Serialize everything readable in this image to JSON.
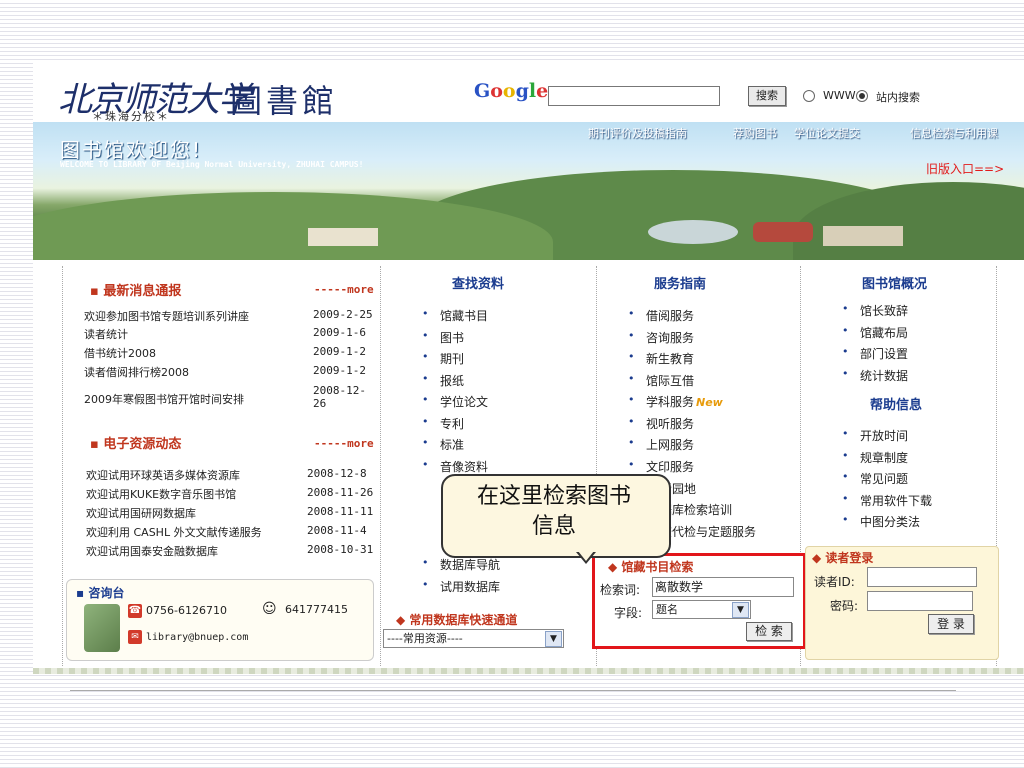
{
  "header": {
    "logo_cn": "北京师范大学",
    "logo_sub": "＊珠海分校＊",
    "logo_lib": "圖書館",
    "google": [
      "G",
      "o",
      "o",
      "g",
      "l",
      "e"
    ],
    "search_button": "搜索",
    "radio_www": "WWW",
    "radio_site": "站内搜索"
  },
  "banner": {
    "title": "图书馆欢迎您!",
    "subtitle": "WELCOME TO LIBRARY OF Beijing Normal University, ZHUHAI CAMPUS!",
    "nav": [
      "期刊评价及投稿指南",
      "荐购图书",
      "学位论文提交",
      "信息检索与利用课"
    ],
    "old_entry": "旧版入口==>"
  },
  "news": {
    "title": "最新消息通报",
    "more": "-----more",
    "items": [
      {
        "text": "欢迎参加图书馆专题培训系列讲座",
        "date": "2009-2-25"
      },
      {
        "text": "读者统计",
        "date": "2009-1-6"
      },
      {
        "text": "借书统计2008",
        "date": "2009-1-2"
      },
      {
        "text": "读者借阅排行榜2008",
        "date": "2009-1-2"
      },
      {
        "text": "2009年寒假图书馆开馆时间安排",
        "date": "2008-12-26"
      }
    ]
  },
  "eresource": {
    "title": "电子资源动态",
    "more": "-----more",
    "items": [
      {
        "text": "欢迎试用环球英语多媒体资源库",
        "date": "2008-12-8"
      },
      {
        "text": "欢迎试用KUKE数字音乐图书馆",
        "date": "2008-11-26"
      },
      {
        "text": "欢迎试用国研网数据库",
        "date": "2008-11-11"
      },
      {
        "text": "欢迎利用 CASHL 外文文献传递服务",
        "date": "2008-11-4"
      },
      {
        "text": "欢迎试用国泰安金融数据库",
        "date": "2008-10-31"
      }
    ]
  },
  "consult": {
    "title": "咨询台",
    "phone": "0756-6126710",
    "qq": "641777415",
    "email": "library@bnuep.com"
  },
  "find": {
    "title": "查找资料",
    "items": [
      "馆藏书目",
      "图书",
      "期刊",
      "报纸",
      "学位论文",
      "专利",
      "标准",
      "音像资料"
    ],
    "items2": [
      "数据库导航",
      "试用数据库"
    ]
  },
  "quick": {
    "title": "常用数据库快速通道",
    "select": "----常用资源----"
  },
  "service": {
    "title": "服务指南",
    "items": [
      "借阅服务",
      "咨询服务",
      "新生教育",
      "馆际互借",
      "学科服务",
      "视听服务",
      "上网服务",
      "文印服务"
    ],
    "new_badge": "New",
    "partial": [
      "者园地",
      "据库检索培训",
      "查代检与定题服务"
    ]
  },
  "overview": {
    "title": "图书馆概况",
    "items": [
      "馆长致辞",
      "馆藏布局",
      "部门设置",
      "统计数据"
    ]
  },
  "help": {
    "title": "帮助信息",
    "items": [
      "开放时间",
      "规章制度",
      "常见问题",
      "常用软件下载",
      "中图分类法"
    ]
  },
  "catalog": {
    "title": "馆藏书目检索",
    "keyword_label": "检索词:",
    "keyword_value": "离散数学",
    "field_label": "字段:",
    "field_value": "题名",
    "button": "检 索"
  },
  "login": {
    "title": "读者登录",
    "id_label": "读者ID:",
    "pwd_label": "密码:",
    "button": "登 录"
  },
  "callout": {
    "line1": "在这里检索图书",
    "line2": "信息"
  },
  "colors": {
    "accent_red": "#e2161a",
    "title_blue": "#1b3c8f",
    "title_red": "#c0361e"
  }
}
